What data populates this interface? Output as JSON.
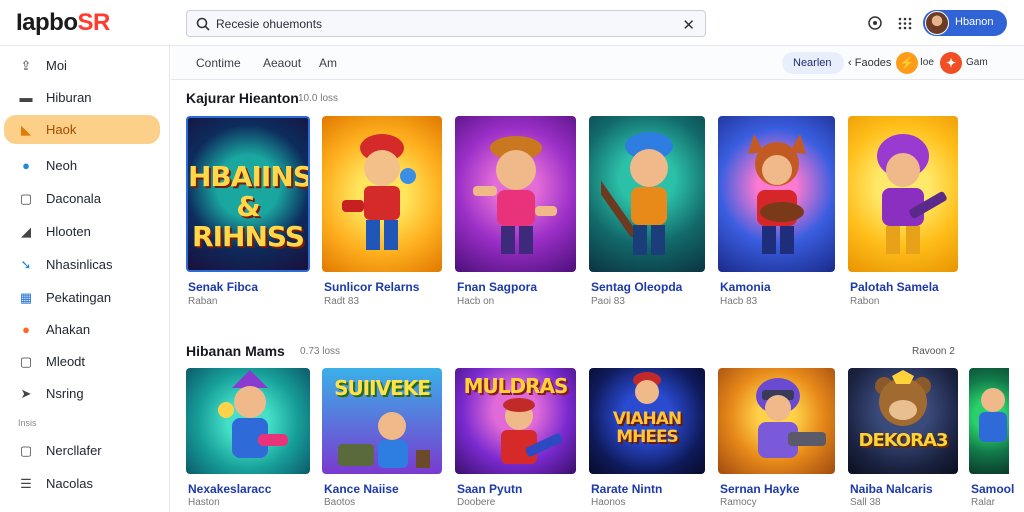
{
  "app": {
    "logo_main": "Iapbo",
    "logo_accent": "SR"
  },
  "search": {
    "value": "Recesie ohuemonts"
  },
  "user": {
    "name": "Hbanon"
  },
  "sidebar": {
    "items": [
      {
        "label": "Moi",
        "icon": "upload-icon"
      },
      {
        "label": "Hiburan",
        "icon": "folder-icon"
      },
      {
        "label": "Haok",
        "icon": "gamepad-icon",
        "active": true
      },
      {
        "label": "Neoh",
        "icon": "info-icon"
      },
      {
        "label": "Daconala",
        "icon": "document-icon"
      },
      {
        "label": "Hlooten",
        "icon": "pen-icon"
      },
      {
        "label": "Nhasinlicas",
        "icon": "arrow-icon"
      },
      {
        "label": "Pekatingan",
        "icon": "grid-icon"
      },
      {
        "label": "Ahakan",
        "icon": "flame-icon"
      },
      {
        "label": "Mleodt",
        "icon": "chat-icon"
      },
      {
        "label": "Nsring",
        "icon": "send-icon"
      }
    ],
    "section_label": "Insis",
    "items2": [
      {
        "label": "Nercllafer",
        "icon": "message-icon"
      },
      {
        "label": "Nacolas",
        "icon": "list-icon"
      }
    ]
  },
  "tabs": [
    "Contime",
    "Aeaout",
    "Am"
  ],
  "filters": {
    "active": "Nearlen",
    "text": "Faodes",
    "badge1_label": "Ioe",
    "badge2_label": "Gam"
  },
  "section1": {
    "title": "Kajurar Hieanton",
    "count": "10.0 loss",
    "cards": [
      {
        "title": "Senak Fibca",
        "sub": "Raban",
        "art": "HBAIINS & RIHNSS"
      },
      {
        "title": "Sunlicor Relarns",
        "sub": "Radt 83"
      },
      {
        "title": "Fnan Sagpora",
        "sub": "Hacb on"
      },
      {
        "title": "Sentag Oleopda",
        "sub": "Paoi 83"
      },
      {
        "title": "Kamonia",
        "sub": "Hacb 83"
      },
      {
        "title": "Palotah Samela",
        "sub": "Rabon"
      }
    ]
  },
  "section2": {
    "title": "Hibanan Mams",
    "count": "0.73 loss",
    "see_all": "Ravoon 2",
    "cards": [
      {
        "title": "Nexakeslaracc",
        "sub": "Haston"
      },
      {
        "title": "Kance Naiise",
        "sub": "Baotos",
        "art": "SUIIVEKE"
      },
      {
        "title": "Saan Pyutn",
        "sub": "Doobere",
        "art": "MULDRAS"
      },
      {
        "title": "Rarate Nintn",
        "sub": "Haonos",
        "art": "VIAHAN MHEES"
      },
      {
        "title": "Sernan Hayke",
        "sub": "Ramocy"
      },
      {
        "title": "Naiba Nalcaris",
        "sub": "Sall 38",
        "art": "DEKORA3"
      },
      {
        "title": "Samool",
        "sub": "Ralar"
      }
    ]
  }
}
